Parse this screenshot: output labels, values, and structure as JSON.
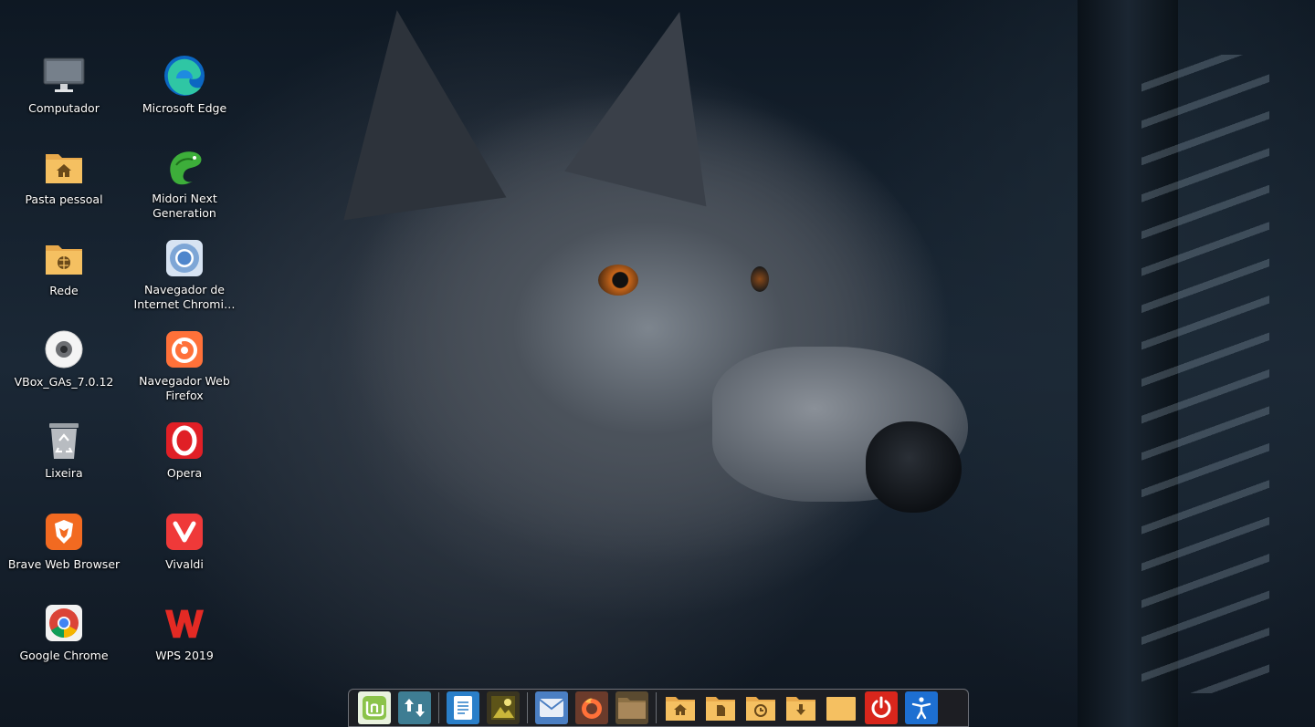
{
  "desktop": {
    "icons_col1": [
      {
        "label": "Computador",
        "icon": "computer-icon"
      },
      {
        "label": "Pasta pessoal",
        "icon": "home-folder-icon"
      },
      {
        "label": "Rede",
        "icon": "network-folder-icon"
      },
      {
        "label": "VBox_GAs_7.0.12",
        "icon": "optical-disc-icon"
      },
      {
        "label": "Lixeira",
        "icon": "trash-icon"
      },
      {
        "label": "Brave Web Browser",
        "icon": "brave-icon"
      },
      {
        "label": "Google Chrome",
        "icon": "chrome-icon"
      }
    ],
    "icons_col2": [
      {
        "label": "Microsoft Edge",
        "icon": "edge-icon"
      },
      {
        "label": "Midori Next Generation",
        "icon": "midori-icon"
      },
      {
        "label": "Navegador de Internet Chromi…",
        "icon": "chromium-icon"
      },
      {
        "label": "Navegador Web Firefox",
        "icon": "firefox-icon"
      },
      {
        "label": "Opera",
        "icon": "opera-icon"
      },
      {
        "label": "Vivaldi",
        "icon": "vivaldi-icon"
      },
      {
        "label": "WPS 2019",
        "icon": "wps-icon"
      }
    ]
  },
  "dock": {
    "items": [
      "mint-menu-icon",
      "update-manager-icon",
      "text-editor-icon",
      "image-viewer-icon",
      "mail-icon",
      "firefox-icon",
      "file-manager-icon",
      "home-folder-icon",
      "documents-folder-icon",
      "recent-folder-icon",
      "downloads-folder-icon",
      "folder-icon",
      "power-icon",
      "accessibility-icon"
    ]
  },
  "colors": {
    "dock_bg": "#1e2024",
    "label_text": "#ffffff",
    "folder": "#f5c061"
  }
}
